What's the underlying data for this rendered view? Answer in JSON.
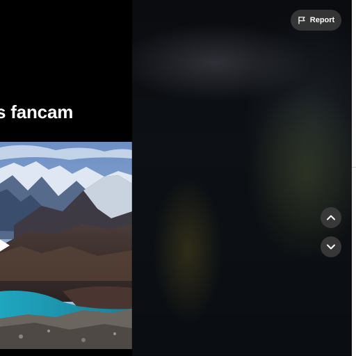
{
  "video": {
    "title": "s fancam"
  },
  "toolbar": {
    "report_label": "Report"
  },
  "icons": {
    "report": "flag-icon",
    "prev": "chevron-up-icon",
    "next": "chevron-down-icon",
    "play": "play-icon"
  }
}
